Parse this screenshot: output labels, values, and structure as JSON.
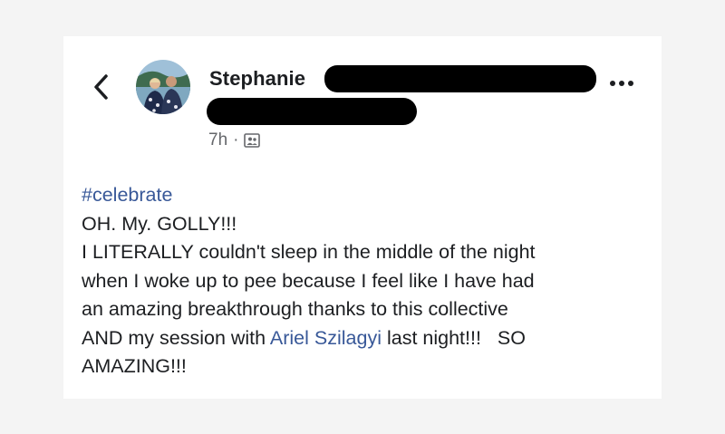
{
  "post": {
    "author": "Stephanie",
    "timestamp": "7h",
    "separator": "·",
    "audience_icon": "friends-icon",
    "hashtag": "#celebrate",
    "lines": [
      "OH.  My.  GOLLY!!!",
      "I LITERALLY couldn't sleep in the middle of the night",
      "when I woke up to pee because I feel like I have had",
      "an amazing breakthrough thanks to this collective"
    ],
    "last_line_prefix": "AND my session with ",
    "mention": "Ariel Szilagyi",
    "last_line_suffix": " last night!!!   SO",
    "final_line": "AMAZING!!!"
  },
  "colors": {
    "text": "#1c1e21",
    "meta": "#65676b",
    "link": "#385898"
  }
}
